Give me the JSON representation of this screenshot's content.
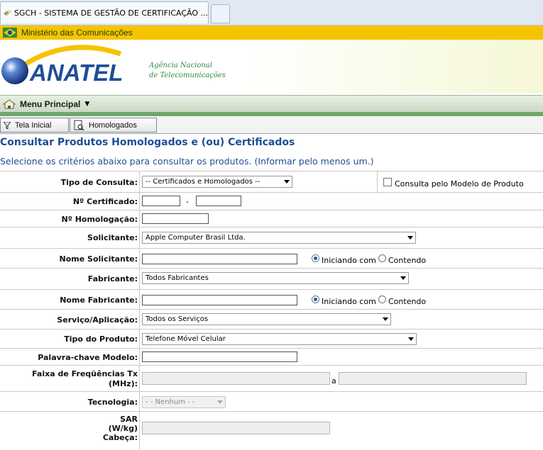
{
  "browser": {
    "tab_title": "SGCH - SISTEMA DE GESTÃO DE CERTIFICAÇÃO ..."
  },
  "header": {
    "ministry": "Ministério das Comunicações",
    "logo_text": "ANATEL",
    "agency_line1": "Agência Nacional",
    "agency_line2": "de Telecomunicações",
    "brand_color": "#1f4e96",
    "accent_color": "#f5c400"
  },
  "menu": {
    "main_label": "Menu Principal"
  },
  "toolbar": {
    "home_label": "Tela Inicial",
    "homologados_label": "Homologados"
  },
  "page": {
    "title": "Consultar Produtos Homologados e (ou) Certificados",
    "subtitle": "Selecione os critérios abaixo para consultar os produtos. (Informar pelo menos um.)"
  },
  "form": {
    "tipo_consulta": {
      "label": "Tipo de Consulta:",
      "value": "-- Certificados e Homologados --"
    },
    "consulta_modelo": {
      "label": "Consulta pelo Modelo de Produto",
      "checked": false
    },
    "num_certificado": {
      "label": "Nº Certificado:",
      "separator": "-"
    },
    "num_homologacao": {
      "label": "Nº Homologação:"
    },
    "solicitante": {
      "label": "Solicitante:",
      "value": "Apple Computer Brasil Ltda."
    },
    "nome_solicitante": {
      "label": "Nome Solicitante:",
      "option_start": "Iniciando com",
      "option_contain": "Contendo"
    },
    "fabricante": {
      "label": "Fabricante:",
      "value": "Todos Fabricantes"
    },
    "nome_fabricante": {
      "label": "Nome Fabricante:",
      "option_start": "Iniciando com",
      "option_contain": "Contendo"
    },
    "servico": {
      "label": "Serviço/Aplicação:",
      "value": "Todos os Serviços"
    },
    "tipo_produto": {
      "label": "Tipo do Produto:",
      "value": "Telefone Móvel Celular"
    },
    "palavra_chave": {
      "label": "Palavra-chave Modelo:"
    },
    "faixa_freq": {
      "label_line1": "Faixa de Freqüências Tx",
      "label_line2": "(MHz):",
      "separator": "a"
    },
    "tecnologia": {
      "label": "Tecnologia:",
      "value": "- - Nenhum - -"
    },
    "sar": {
      "label_line1": "SAR",
      "label_line2": "(W/kg)",
      "label_line3": "Cabeça:"
    }
  }
}
